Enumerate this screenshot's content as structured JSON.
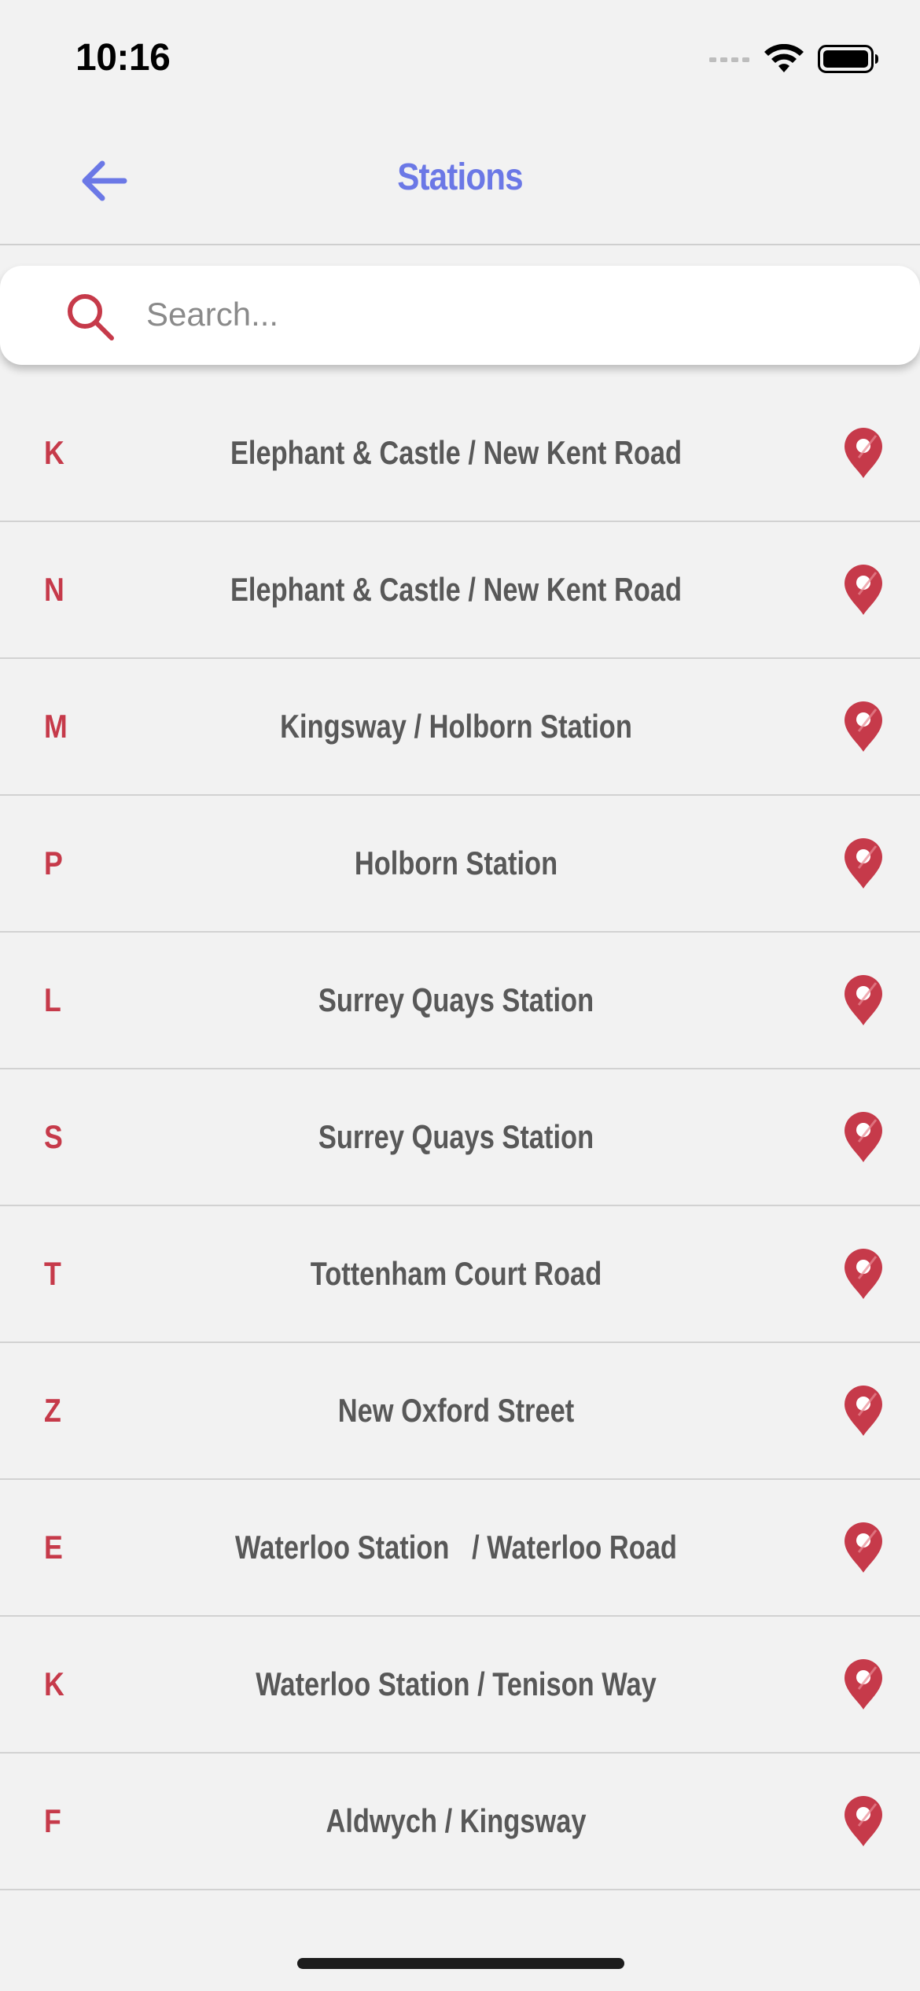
{
  "status_bar": {
    "time": "10:16"
  },
  "nav": {
    "title": "Stations",
    "back_icon": "arrow-left-icon"
  },
  "search": {
    "placeholder": "Search...",
    "value": "",
    "icon": "search-icon"
  },
  "stations": [
    {
      "letter": "K",
      "name": "Elephant & Castle / New Kent Road"
    },
    {
      "letter": "N",
      "name": "Elephant & Castle / New Kent Road"
    },
    {
      "letter": "M",
      "name": "Kingsway / Holborn Station"
    },
    {
      "letter": "P",
      "name": "Holborn Station"
    },
    {
      "letter": "L",
      "name": "Surrey Quays Station"
    },
    {
      "letter": "S",
      "name": "Surrey Quays Station"
    },
    {
      "letter": "T",
      "name": "Tottenham Court Road"
    },
    {
      "letter": "Z",
      "name": "New Oxford Street"
    },
    {
      "letter": "E",
      "name": "Waterloo Station   / Waterloo Road"
    },
    {
      "letter": "K",
      "name": "Waterloo Station / Tenison Way"
    },
    {
      "letter": "F",
      "name": "Aldwych / Kingsway"
    }
  ],
  "colors": {
    "accent": "#6b78e6",
    "brand_red": "#c63a4a",
    "text_gray": "#585858",
    "background": "#f2f2f2"
  }
}
